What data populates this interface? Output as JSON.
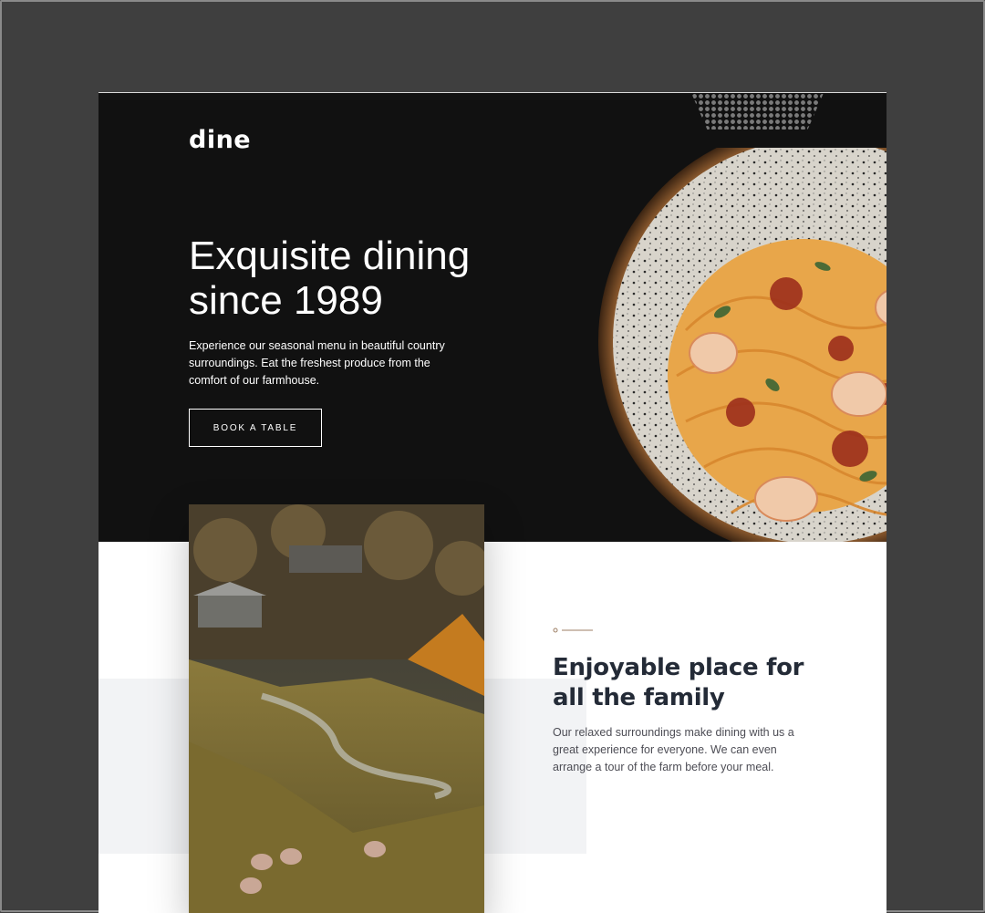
{
  "brand": {
    "logo": "dine"
  },
  "hero": {
    "title": "Exquisite dining since 1989",
    "description": "Experience our seasonal menu in beautiful country surroundings. Eat the freshest produce from the comfort of our farmhouse.",
    "cta_label": "BOOK A TABLE"
  },
  "feature": {
    "title": "Enjoyable place for all the family",
    "description": "Our relaxed surroundings make dining with us a great experience for everyone. We can even arrange a tour of the farm before your meal."
  },
  "colors": {
    "hero_bg": "#111111",
    "accent": "#9e7f66",
    "heading": "#242b37",
    "frame": "#3f3f3f"
  }
}
